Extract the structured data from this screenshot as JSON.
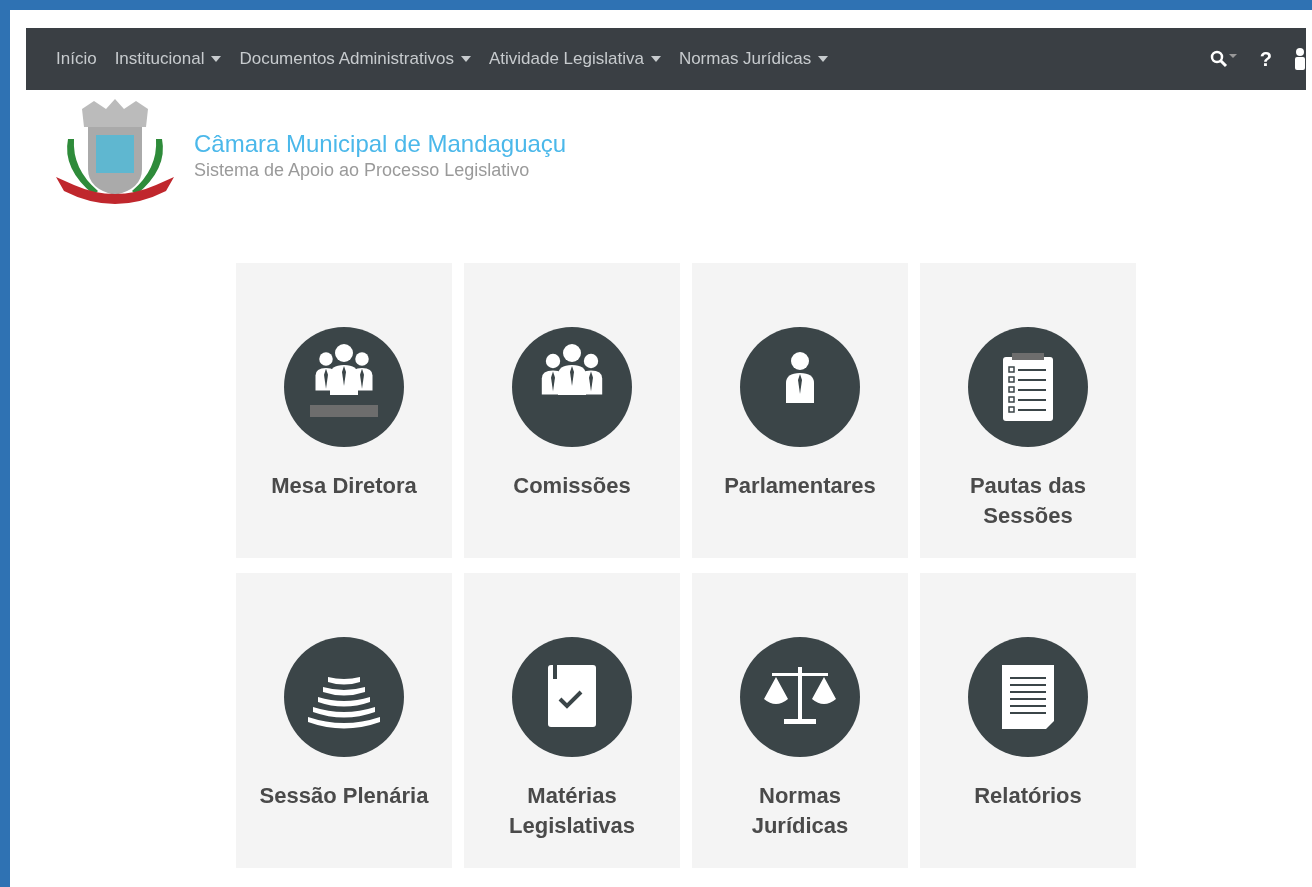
{
  "navbar": {
    "items": [
      {
        "label": "Início",
        "dropdown": false
      },
      {
        "label": "Institucional",
        "dropdown": true
      },
      {
        "label": "Documentos Administrativos",
        "dropdown": true
      },
      {
        "label": "Atividade Legislativa",
        "dropdown": true
      },
      {
        "label": "Normas Jurídicas",
        "dropdown": true
      }
    ],
    "help": "?"
  },
  "header": {
    "title": "Câmara Municipal de Mandaguaçu",
    "subtitle": "Sistema de Apoio ao Processo Legislativo"
  },
  "tiles": [
    {
      "label": "Mesa Diretora",
      "kind": "board"
    },
    {
      "label": "Comissões",
      "kind": "committee"
    },
    {
      "label": "Parlamentares",
      "kind": "member"
    },
    {
      "label": "Pautas das Sessões",
      "kind": "agenda"
    },
    {
      "label": "Sessão Plenária",
      "kind": "plenary"
    },
    {
      "label": "Matérias Legislativas",
      "kind": "bill"
    },
    {
      "label": "Normas Jurídicas",
      "kind": "law"
    },
    {
      "label": "Relatórios",
      "kind": "report"
    }
  ]
}
